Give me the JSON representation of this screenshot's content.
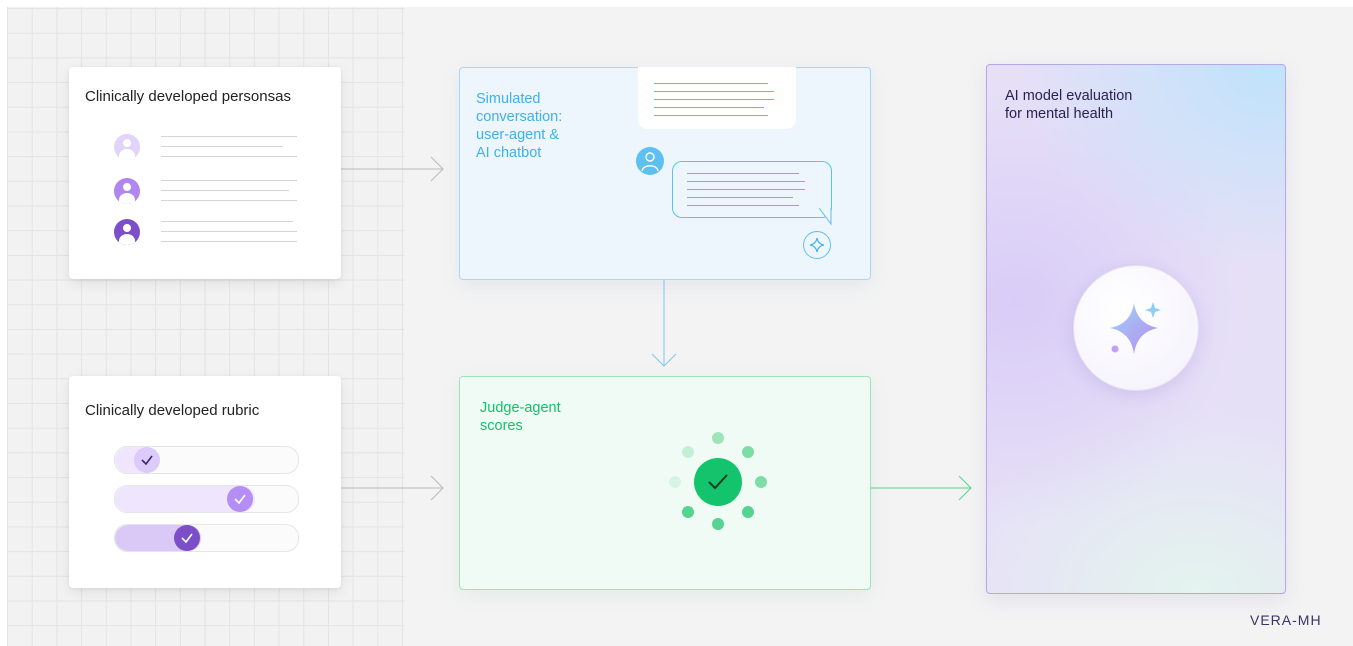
{
  "personas_card": {
    "title": "Clinically developed personsas"
  },
  "rubric_card": {
    "title": "Clinically developed rubric"
  },
  "simulation": {
    "title": "Simulated\nconversation:\nuser-agent &\nAI chatbot"
  },
  "judge": {
    "title": "Judge-agent\nscores"
  },
  "evaluation": {
    "title": "AI model evaluation\nfor mental health"
  },
  "brand": {
    "label": "VERA-MH"
  },
  "colors": {
    "persona_light": "#e2d3fa",
    "persona_mid": "#b186f0",
    "persona_dark": "#7c4fc9",
    "sim_accent": "#3fb0ea",
    "judge_accent": "#13c26a",
    "eval_text": "#2a2150"
  },
  "icons": [
    "person-icon",
    "sparkle-icon",
    "check-icon",
    "arrow-right-icon",
    "arrow-down-icon"
  ]
}
